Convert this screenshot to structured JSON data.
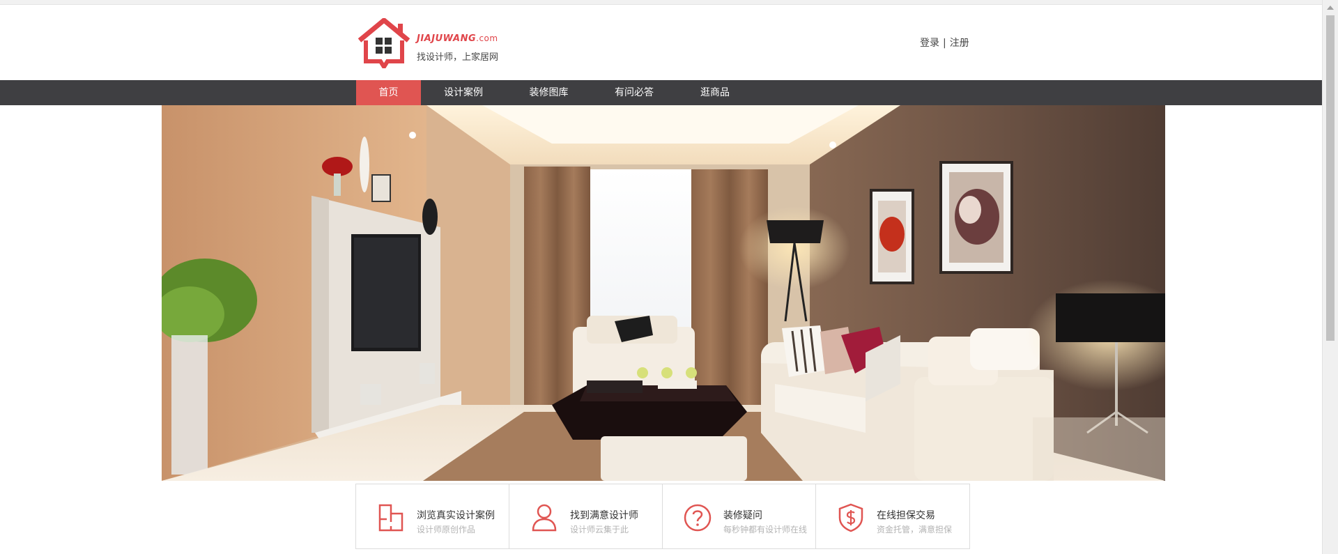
{
  "header": {
    "logo": {
      "brand": "JIAJUWANG",
      "brand_suffix": ".com",
      "slogan": "找设计师，上家居网",
      "icon": "house-logo-icon"
    },
    "auth": {
      "login": "登录",
      "separator": "|",
      "register": "注册"
    }
  },
  "nav": {
    "items": [
      {
        "label": "首页",
        "active": true
      },
      {
        "label": "设计案例",
        "active": false
      },
      {
        "label": "装修图库",
        "active": false
      },
      {
        "label": "有问必答",
        "active": false
      },
      {
        "label": "逛商品",
        "active": false
      }
    ]
  },
  "hero": {
    "image": "living-room-banner"
  },
  "features": [
    {
      "icon": "floorplan-icon",
      "title": "浏览真实设计案例",
      "subtitle": "设计师原创作品"
    },
    {
      "icon": "user-icon",
      "title": "找到满意设计师",
      "subtitle": "设计师云集于此"
    },
    {
      "icon": "question-icon",
      "title": "装修疑问",
      "subtitle": "每秒钟都有设计师在线"
    },
    {
      "icon": "shield-dollar-icon",
      "title": "在线担保交易",
      "subtitle": "资金托管，满意担保"
    }
  ],
  "colors": {
    "accent": "#e05552",
    "nav_bg": "#3f3f42",
    "muted_text": "#b3b3b3"
  }
}
